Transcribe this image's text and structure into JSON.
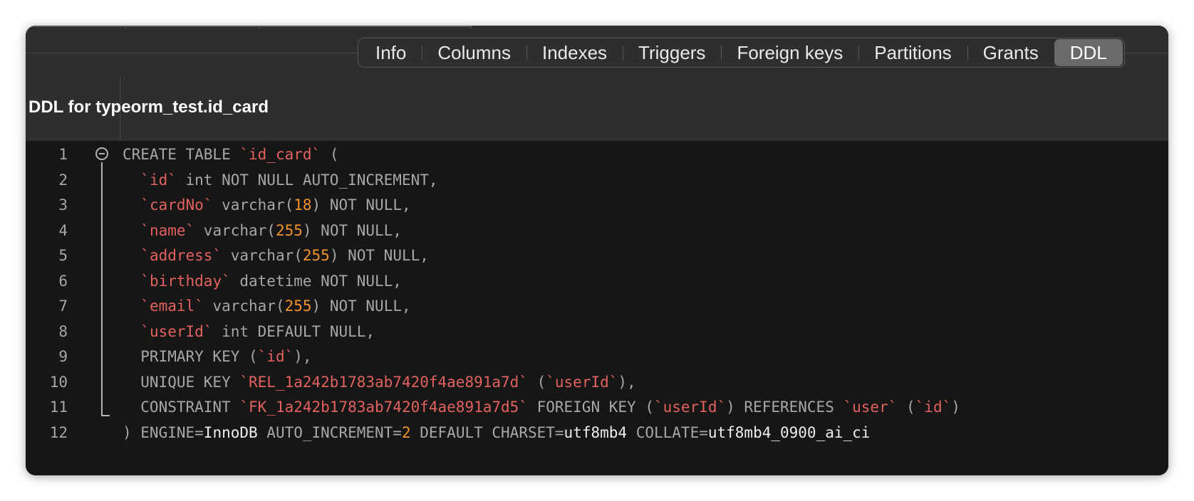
{
  "tabs": [
    {
      "label": "Info",
      "active": false
    },
    {
      "label": "Columns",
      "active": false
    },
    {
      "label": "Indexes",
      "active": false
    },
    {
      "label": "Triggers",
      "active": false
    },
    {
      "label": "Foreign keys",
      "active": false
    },
    {
      "label": "Partitions",
      "active": false
    },
    {
      "label": "Grants",
      "active": false
    },
    {
      "label": "DDL",
      "active": true
    }
  ],
  "title": "DDL for typeorm_test.id_card",
  "colors": {
    "background": "#161616",
    "toolbar": "#2e2e2e",
    "identifier": "#e0625f",
    "number": "#f0932c",
    "keyword": "#a7a7a7",
    "value": "#ededed"
  },
  "icons": {
    "fold": "collapse-circle-icon"
  },
  "code_lines": [
    {
      "number": "1",
      "tokens": [
        [
          "kw",
          "CREATE TABLE "
        ],
        [
          "id",
          "`id_card`"
        ],
        [
          "kw",
          " ("
        ]
      ]
    },
    {
      "number": "2",
      "tokens": [
        [
          "kw",
          "  "
        ],
        [
          "id",
          "`id`"
        ],
        [
          "kw",
          " int NOT NULL AUTO_INCREMENT,"
        ]
      ]
    },
    {
      "number": "3",
      "tokens": [
        [
          "kw",
          "  "
        ],
        [
          "id",
          "`cardNo`"
        ],
        [
          "kw",
          " varchar("
        ],
        [
          "num",
          "18"
        ],
        [
          "kw",
          ") NOT NULL,"
        ]
      ]
    },
    {
      "number": "4",
      "tokens": [
        [
          "kw",
          "  "
        ],
        [
          "id",
          "`name`"
        ],
        [
          "kw",
          " varchar("
        ],
        [
          "num",
          "255"
        ],
        [
          "kw",
          ") NOT NULL,"
        ]
      ]
    },
    {
      "number": "5",
      "tokens": [
        [
          "kw",
          "  "
        ],
        [
          "id",
          "`address`"
        ],
        [
          "kw",
          " varchar("
        ],
        [
          "num",
          "255"
        ],
        [
          "kw",
          ") NOT NULL,"
        ]
      ]
    },
    {
      "number": "6",
      "tokens": [
        [
          "kw",
          "  "
        ],
        [
          "id",
          "`birthday`"
        ],
        [
          "kw",
          " datetime NOT NULL,"
        ]
      ]
    },
    {
      "number": "7",
      "tokens": [
        [
          "kw",
          "  "
        ],
        [
          "id",
          "`email`"
        ],
        [
          "kw",
          " varchar("
        ],
        [
          "num",
          "255"
        ],
        [
          "kw",
          ") NOT NULL,"
        ]
      ]
    },
    {
      "number": "8",
      "tokens": [
        [
          "kw",
          "  "
        ],
        [
          "id",
          "`userId`"
        ],
        [
          "kw",
          " int DEFAULT NULL,"
        ]
      ]
    },
    {
      "number": "9",
      "tokens": [
        [
          "kw",
          "  PRIMARY KEY ("
        ],
        [
          "id",
          "`id`"
        ],
        [
          "kw",
          "),"
        ]
      ]
    },
    {
      "number": "10",
      "tokens": [
        [
          "kw",
          "  UNIQUE KEY "
        ],
        [
          "id",
          "`REL_1a242b1783ab7420f4ae891a7d`"
        ],
        [
          "kw",
          " ("
        ],
        [
          "id",
          "`userId`"
        ],
        [
          "kw",
          "),"
        ]
      ]
    },
    {
      "number": "11",
      "tokens": [
        [
          "kw",
          "  CONSTRAINT "
        ],
        [
          "id",
          "`FK_1a242b1783ab7420f4ae891a7d5`"
        ],
        [
          "kw",
          " FOREIGN KEY ("
        ],
        [
          "id",
          "`userId`"
        ],
        [
          "kw",
          ") REFERENCES "
        ],
        [
          "id",
          "`user`"
        ],
        [
          "kw",
          " ("
        ],
        [
          "id",
          "`id`"
        ],
        [
          "kw",
          ")"
        ]
      ]
    },
    {
      "number": "12",
      "tokens": [
        [
          "kw",
          ") ENGINE="
        ],
        [
          "val",
          "InnoDB"
        ],
        [
          "kw",
          " AUTO_INCREMENT="
        ],
        [
          "num",
          "2"
        ],
        [
          "kw",
          " DEFAULT CHARSET="
        ],
        [
          "val",
          "utf8mb4"
        ],
        [
          "kw",
          " COLLATE="
        ],
        [
          "val",
          "utf8mb4_0900_ai_ci"
        ]
      ]
    }
  ]
}
